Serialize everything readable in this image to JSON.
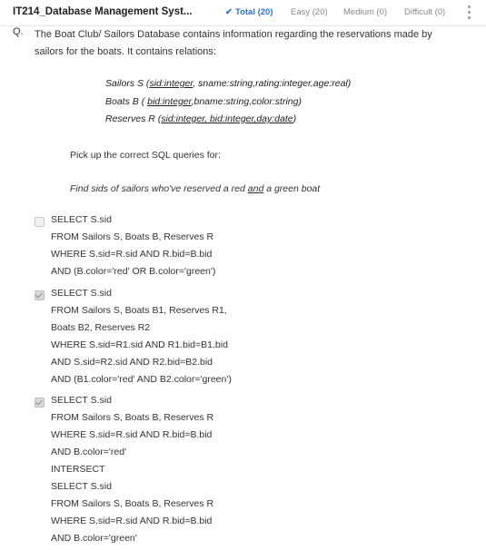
{
  "header": {
    "course_title": "IT214_Database Management Syst...",
    "filters": [
      {
        "label": "Total (20)",
        "active": true
      },
      {
        "label": "Easy (20)",
        "active": false
      },
      {
        "label": "Medium (0)",
        "active": false
      },
      {
        "label": "Difficult (0)",
        "active": false
      }
    ],
    "menu_icon": "kebab-menu-icon"
  },
  "question": {
    "label": "Q.",
    "text": "The Boat Club/ Sailors Database contains information regarding the reservations made by sailors for the boats. It contains relations:",
    "relations": [
      {
        "prefix": "Sailors S (",
        "key": "sid:integer",
        "rest": ", sname:string,rating:integer,age:real)"
      },
      {
        "prefix": "Boats B ( ",
        "key": "bid:integer",
        "rest": ",bname:string,color:string)"
      },
      {
        "prefix": "Reserves R (",
        "key": "sid:integer, bid:integer,day:date",
        "rest": ")"
      }
    ],
    "instruction": "Pick up the correct SQL queries for:",
    "task_before": "Find sids of sailors who've reserved a red ",
    "task_and": "and",
    "task_after": " a green boat"
  },
  "options": [
    {
      "checked": false,
      "lines": [
        "SELECT  S.sid",
        "FROM  Sailors S, Boats B, Reserves R",
        "WHERE  S.sid=R.sid AND R.bid=B.bid",
        "AND (B.color='red' OR B.color='green')"
      ]
    },
    {
      "checked": true,
      "lines": [
        "SELECT  S.sid",
        "FROM  Sailors S, Boats B1, Reserves R1,",
        "Boats B2, Reserves R2",
        "WHERE  S.sid=R1.sid AND R1.bid=B1.bid",
        "AND  S.sid=R2.sid AND R2.bid=B2.bid",
        "AND (B1.color='red' AND B2.color='green')"
      ]
    },
    {
      "checked": true,
      "lines": [
        "SELECT  S.sid",
        "FROM  Sailors S, Boats B, Reserves R",
        "WHERE  S.sid=R.sid AND R.bid=B.bid",
        "AND B.color='red'",
        "INTERSECT",
        "SELECT  S.sid",
        "FROM  Sailors S, Boats B, Reserves R",
        "WHERE  S.sid=R.sid AND R.bid=B.bid",
        "AND B.color='green'"
      ]
    }
  ]
}
